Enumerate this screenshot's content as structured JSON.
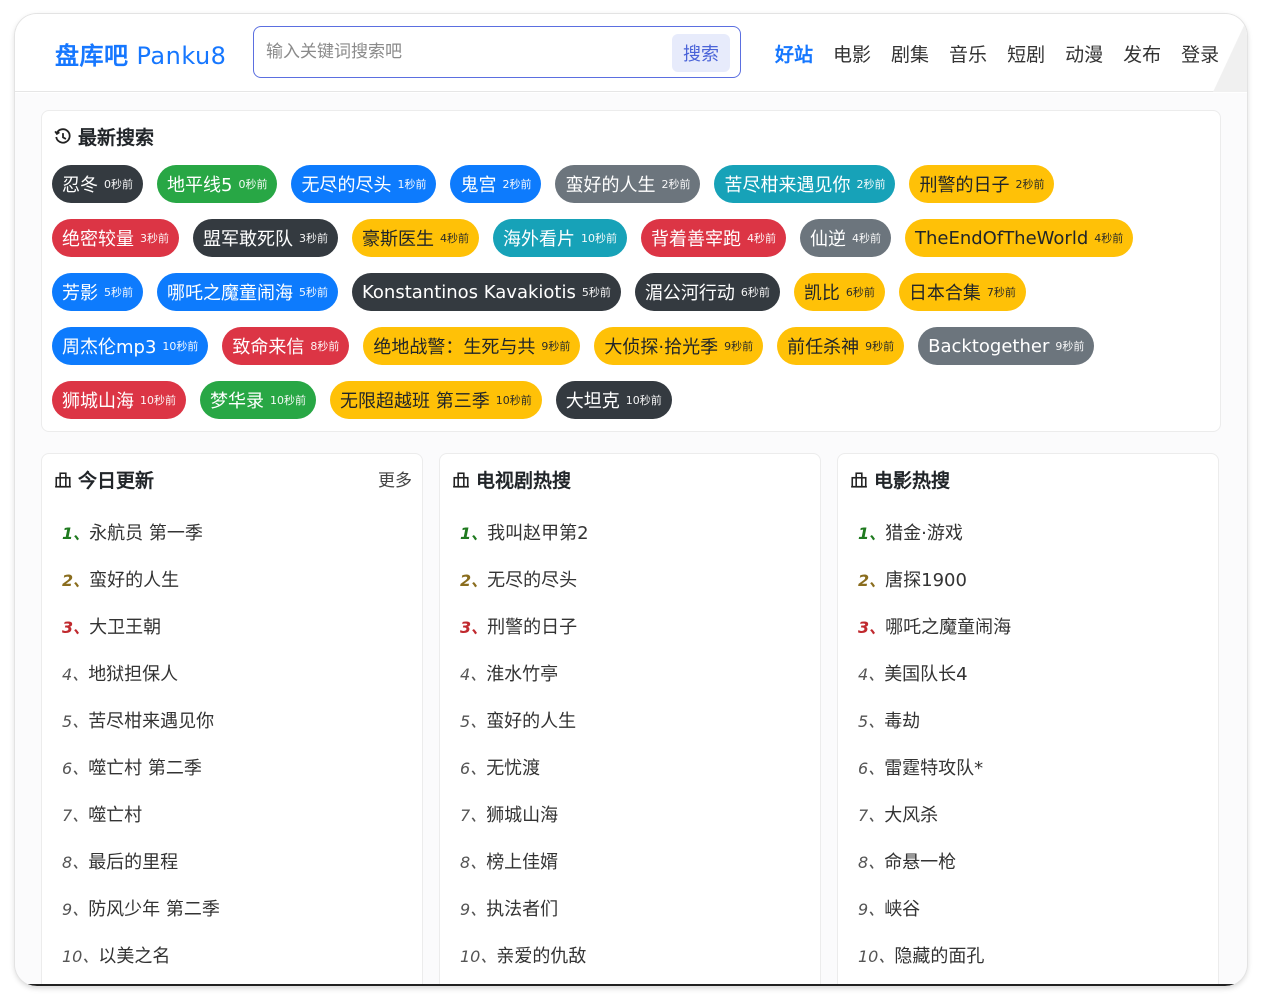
{
  "header": {
    "brand_cn": "盘库吧",
    "brand_en": "Panku8",
    "search_placeholder": "输入关键词搜索吧",
    "search_button": "搜索",
    "nav": [
      "好站",
      "电影",
      "剧集",
      "音乐",
      "短剧",
      "动漫",
      "发布",
      "登录"
    ],
    "nav_active": "好站"
  },
  "recent": {
    "title": "最新搜索",
    "icon": "history-icon",
    "rows": [
      [
        {
          "text": "忍冬",
          "time": "0秒前",
          "color": "dark"
        },
        {
          "text": "地平线5",
          "time": "0秒前",
          "color": "green"
        },
        {
          "text": "无尽的尽头",
          "time": "1秒前",
          "color": "blue"
        },
        {
          "text": "鬼宫",
          "time": "2秒前",
          "color": "blue"
        },
        {
          "text": "蛮好的人生",
          "time": "2秒前",
          "color": "gray"
        },
        {
          "text": "苦尽柑来遇见你",
          "time": "2秒前",
          "color": "teal"
        },
        {
          "text": "刑警的日子",
          "time": "2秒前",
          "color": "yellow"
        }
      ],
      [
        {
          "text": "绝密较量",
          "time": "3秒前",
          "color": "red"
        },
        {
          "text": "盟军敢死队",
          "time": "3秒前",
          "color": "dark"
        },
        {
          "text": "豪斯医生",
          "time": "4秒前",
          "color": "yellow"
        },
        {
          "text": "海外看片",
          "time": "10秒前",
          "color": "teal"
        },
        {
          "text": "背着善宰跑",
          "time": "4秒前",
          "color": "red"
        },
        {
          "text": "仙逆",
          "time": "4秒前",
          "color": "gray"
        },
        {
          "text": "TheEndOfTheWorld",
          "time": "4秒前",
          "color": "yellow"
        }
      ],
      [
        {
          "text": "芳影",
          "time": "5秒前",
          "color": "blue"
        },
        {
          "text": "哪吒之魔童闹海",
          "time": "5秒前",
          "color": "blue"
        },
        {
          "text": "Konstantinos Kavakiotis",
          "time": "5秒前",
          "color": "dark"
        },
        {
          "text": "湄公河行动",
          "time": "6秒前",
          "color": "dark"
        },
        {
          "text": "凯比",
          "time": "6秒前",
          "color": "yellow"
        },
        {
          "text": "日本合集",
          "time": "7秒前",
          "color": "yellow"
        }
      ],
      [
        {
          "text": "周杰伦mp3",
          "time": "10秒前",
          "color": "blue"
        },
        {
          "text": "致命来信",
          "time": "8秒前",
          "color": "red"
        },
        {
          "text": "绝地战警：生死与共",
          "time": "9秒前",
          "color": "yellow"
        },
        {
          "text": "大侦探·拾光季",
          "time": "9秒前",
          "color": "yellow"
        },
        {
          "text": "前任杀神",
          "time": "9秒前",
          "color": "yellow"
        },
        {
          "text": "Backtogether",
          "time": "9秒前",
          "color": "gray"
        }
      ],
      [
        {
          "text": "狮城山海",
          "time": "10秒前",
          "color": "red"
        },
        {
          "text": "梦华录",
          "time": "10秒前",
          "color": "green"
        },
        {
          "text": "无限超越班 第三季",
          "time": "10秒前",
          "color": "yellow"
        },
        {
          "text": "大坦克",
          "time": "10秒前",
          "color": "dark"
        }
      ]
    ]
  },
  "columns": [
    {
      "title": "今日更新",
      "icon": "building-icon",
      "more": "更多",
      "items": [
        "永航员 第一季",
        "蛮好的人生",
        "大卫王朝",
        "地狱担保人",
        "苦尽柑来遇见你",
        "噬亡村 第二季",
        "噬亡村",
        "最后的里程",
        "防风少年 第二季",
        "以美之名"
      ]
    },
    {
      "title": "电视剧热搜",
      "icon": "building-icon",
      "items": [
        "我叫赵甲第2",
        "无尽的尽头",
        "刑警的日子",
        "淮水竹亭",
        "蛮好的人生",
        "无忧渡",
        "狮城山海",
        "榜上佳婿",
        "执法者们",
        "亲爱的仇敌"
      ]
    },
    {
      "title": "电影热搜",
      "icon": "building-icon",
      "items": [
        "猎金·游戏",
        "唐探1900",
        "哪吒之魔童闹海",
        "美国队长4",
        "毒劫",
        "雷霆特攻队*",
        "大风杀",
        "命悬一枪",
        "峡谷",
        "隐藏的面孔"
      ]
    }
  ],
  "rank_suffix": "、",
  "colors": {
    "brand": "#1677ff",
    "dark": "#343a40",
    "green": "#28a745",
    "blue": "#0d7bfd",
    "gray": "#6c757d",
    "teal": "#17a2b8",
    "yellow": "#ffc107",
    "red": "#dc3545"
  }
}
